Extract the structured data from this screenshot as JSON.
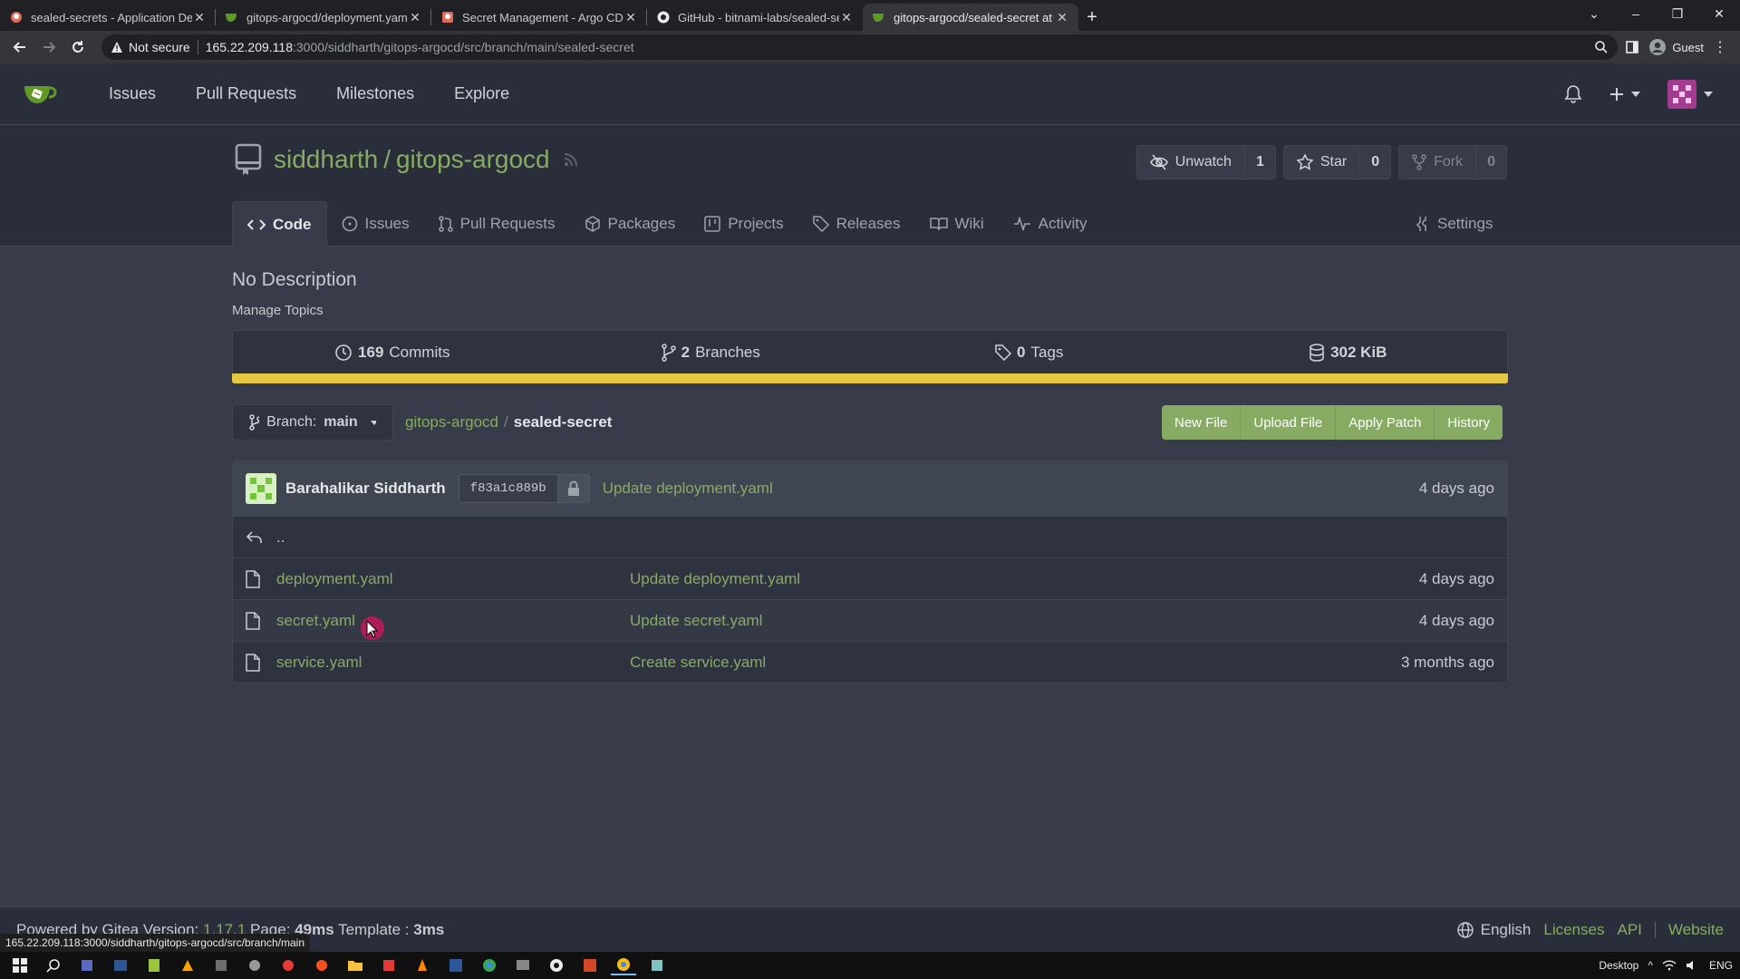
{
  "browser": {
    "tabs": [
      {
        "title": "sealed-secrets - Application Deta",
        "icon": "argocd-icon",
        "active": false
      },
      {
        "title": "gitops-argocd/deployment.yaml",
        "icon": "gitea-icon",
        "active": false
      },
      {
        "title": "Secret Management - Argo CD -",
        "icon": "argocd-icon",
        "active": false
      },
      {
        "title": "GitHub - bitnami-labs/sealed-sec",
        "icon": "github-icon",
        "active": false
      },
      {
        "title": "gitops-argocd/sealed-secret at m",
        "icon": "gitea-icon",
        "active": true
      }
    ],
    "not_secure": "Not secure",
    "url_host": "165.22.209.118",
    "url_path": ":3000/siddharth/gitops-argocd/src/branch/main/sealed-secret",
    "profile": "Guest",
    "status_url": "165.22.209.118:3000/siddharth/gitops-argocd/src/branch/main"
  },
  "nav": {
    "items": [
      "Issues",
      "Pull Requests",
      "Milestones",
      "Explore"
    ]
  },
  "repo": {
    "owner": "siddharth",
    "slash": "/",
    "name": "gitops-argocd",
    "unwatch_label": "Unwatch",
    "watch_count": "1",
    "star_label": "Star",
    "star_count": "0",
    "fork_label": "Fork",
    "fork_count": "0",
    "tabs": [
      "Code",
      "Issues",
      "Pull Requests",
      "Packages",
      "Projects",
      "Releases",
      "Wiki",
      "Activity"
    ],
    "settings_label": "Settings",
    "description": "No Description",
    "manage_topics": "Manage Topics"
  },
  "stats": {
    "commits": "169",
    "commits_label": "Commits",
    "branches": "2",
    "branches_label": "Branches",
    "tags": "0",
    "tags_label": "Tags",
    "size": "302 KiB"
  },
  "toolbar": {
    "branch_prefix": "Branch:",
    "branch": "main",
    "crumb_repo": "gitops-argocd",
    "crumb_sep": "/",
    "crumb_current": "sealed-secret",
    "new_file": "New File",
    "upload_file": "Upload File",
    "apply_patch": "Apply Patch",
    "history": "History"
  },
  "last_commit": {
    "author": "Barahalikar Siddharth",
    "sha": "f83a1c889b",
    "message": "Update deployment.yaml",
    "ago": "4 days ago"
  },
  "parent_dir": "..",
  "files": [
    {
      "name": "deployment.yaml",
      "message": "Update deployment.yaml",
      "ago": "4 days ago"
    },
    {
      "name": "secret.yaml",
      "message": "Update secret.yaml",
      "ago": "4 days ago"
    },
    {
      "name": "service.yaml",
      "message": "Create service.yaml",
      "ago": "3 months ago"
    }
  ],
  "footer": {
    "powered_prefix": "Powered by Gitea Version:",
    "version": "1.17.1",
    "page_label": "Page:",
    "page_time": "49ms",
    "template_label": "Template :",
    "template_time": "3ms",
    "language": "English",
    "licenses": "Licenses",
    "api": "API",
    "website": "Website"
  },
  "taskbar": {
    "desktop_label": "Desktop",
    "lang": "ENG"
  },
  "colors": {
    "accent_green": "#87ab63",
    "lang_bar": "#e5c741",
    "bg": "#383c4a"
  }
}
